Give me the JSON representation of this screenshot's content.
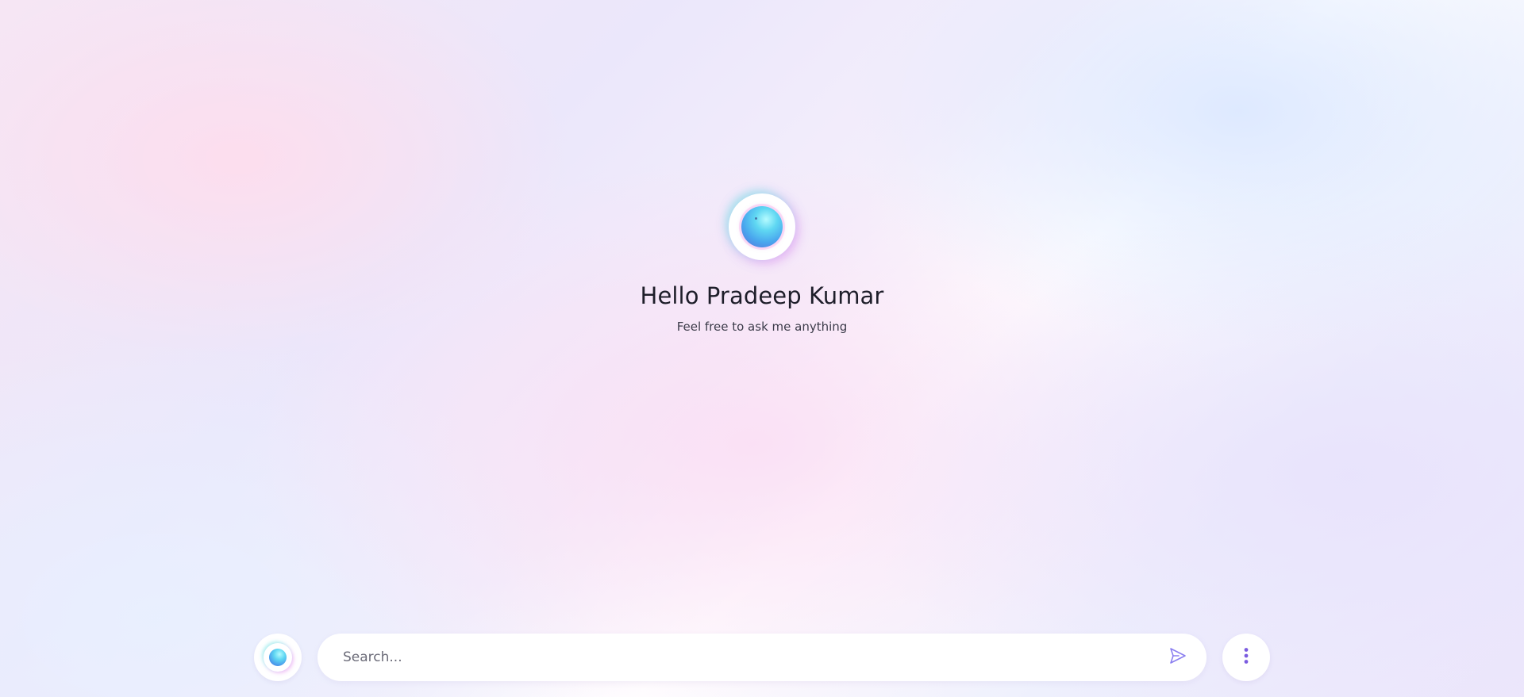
{
  "greeting": {
    "title": "Hello Pradeep Kumar",
    "subtitle": "Feel free to ask me anything"
  },
  "search": {
    "placeholder": "Search...",
    "value": ""
  },
  "icons": {
    "assistant": "assistant-orb-icon",
    "send": "send-icon",
    "more": "more-vertical-icon"
  },
  "colors": {
    "accent": "#7b5ce0",
    "send_icon": "#8b7ff0",
    "title_text": "#1e1e2a"
  }
}
